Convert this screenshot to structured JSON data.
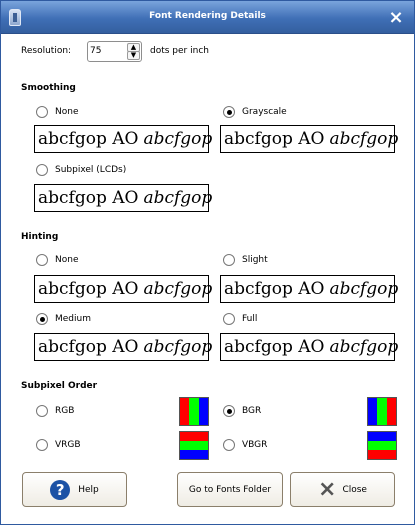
{
  "title": "Font Rendering Details",
  "resolution": {
    "label": "Resolution:",
    "value": "75",
    "unit": "dots per inch"
  },
  "smoothing": {
    "header": "Smoothing",
    "options": [
      {
        "label": "None",
        "selected": false
      },
      {
        "label": "Grayscale",
        "selected": true
      },
      {
        "label": "Subpixel (LCDs)",
        "selected": false
      }
    ]
  },
  "hinting": {
    "header": "Hinting",
    "options": [
      {
        "label": "None",
        "selected": false
      },
      {
        "label": "Slight",
        "selected": false
      },
      {
        "label": "Medium",
        "selected": true
      },
      {
        "label": "Full",
        "selected": false
      }
    ]
  },
  "preview": {
    "regular": "abcfgop AO",
    "italic": "abcfgop"
  },
  "subpixel_order": {
    "header": "Subpixel Order",
    "options": [
      {
        "label": "RGB",
        "selected": false,
        "colors": [
          "#ff0000",
          "#00ff00",
          "#0000ff"
        ]
      },
      {
        "label": "BGR",
        "selected": true,
        "colors": [
          "#0000ff",
          "#00ff00",
          "#ff0000"
        ]
      },
      {
        "label": "VRGB",
        "selected": false,
        "colors": [
          "#ff0000",
          "#00ff00",
          "#0000ff"
        ]
      },
      {
        "label": "VBGR",
        "selected": false,
        "colors": [
          "#0000ff",
          "#00ff00",
          "#ff0000"
        ]
      }
    ]
  },
  "buttons": {
    "help": "Help",
    "fonts_folder": "Go to Fonts Folder",
    "close": "Close"
  }
}
